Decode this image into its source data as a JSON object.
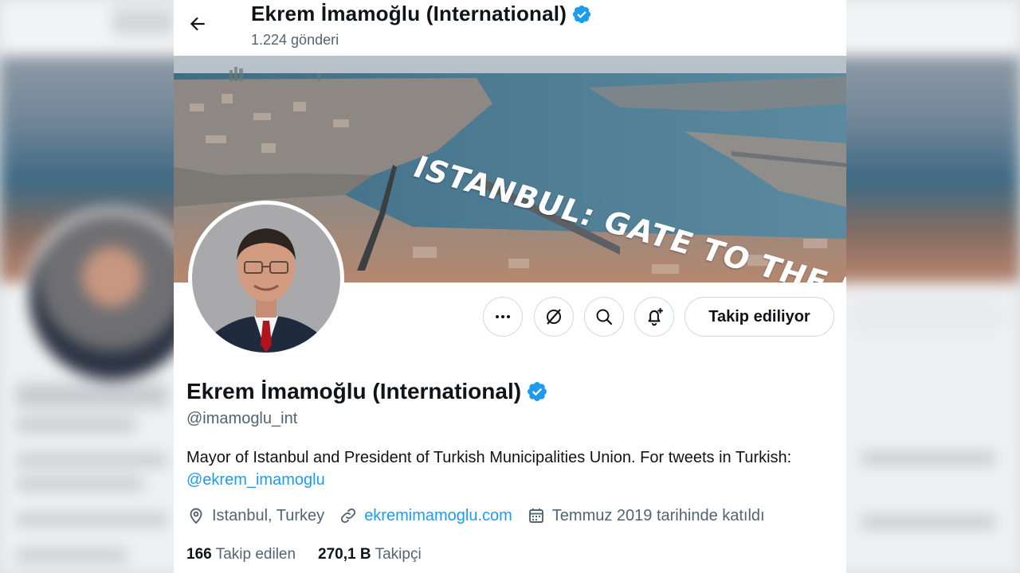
{
  "header": {
    "name": "Ekrem İmamoğlu (International)",
    "post_count": "1.224 gönderi"
  },
  "banner": {
    "text": "ISTANBUL: GATE TO THE BEYOND"
  },
  "actions": {
    "follow_label": "Takip ediliyor"
  },
  "profile": {
    "display_name": "Ekrem İmamoğlu (International)",
    "handle": "@imamoglu_int",
    "bio_text": "Mayor of Istanbul and President of Turkish Municipalities Union. For tweets in Turkish: ",
    "bio_mention": "@ekrem_imamoglu",
    "location": "Istanbul, Turkey",
    "website": "ekremimamoglu.com",
    "joined": "Temmuz 2019 tarihinde katıldı"
  },
  "stats": {
    "following_count": "166",
    "following_label": "Takip edilen",
    "followers_count": "270,1 B",
    "followers_label": "Takipçi"
  },
  "colors": {
    "accent": "#1d9bf0",
    "text_primary": "#0f1419",
    "text_secondary": "#536471",
    "border": "#cfd9de"
  },
  "icons": [
    "back-arrow-icon",
    "verified-badge-icon",
    "more-icon",
    "grok-icon",
    "search-icon",
    "notification-bell-icon",
    "location-pin-icon",
    "link-icon",
    "calendar-icon"
  ]
}
